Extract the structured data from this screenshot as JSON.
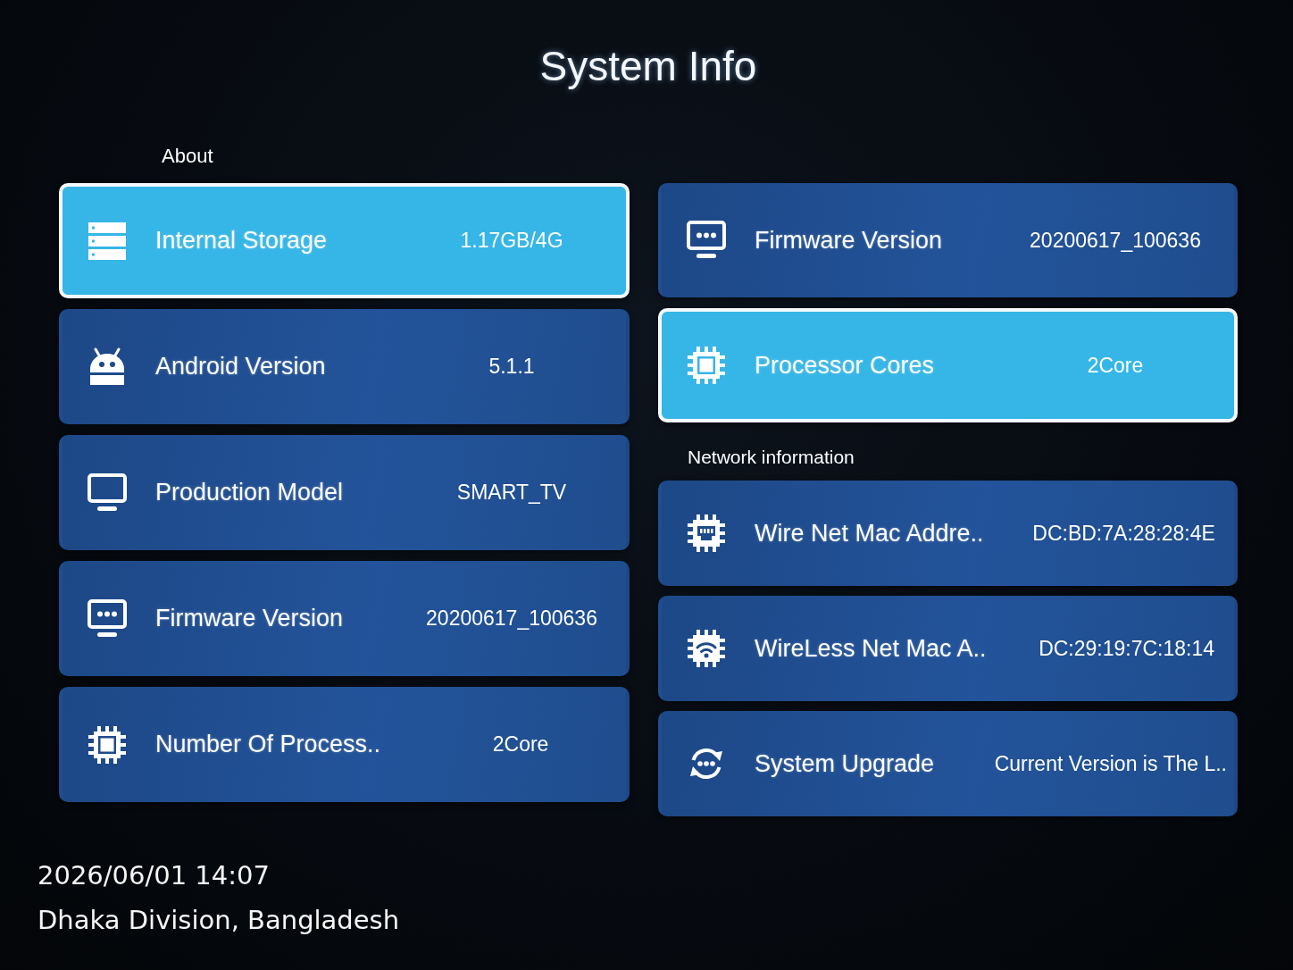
{
  "title": "System Info",
  "about": {
    "heading": "About",
    "items": [
      {
        "kind": "storage",
        "label": "Internal Storage",
        "value": "1.17GB/4G",
        "selected": true
      },
      {
        "kind": "android",
        "label": "Android Version",
        "value": "5.1.1",
        "selected": false
      },
      {
        "kind": "monitor",
        "label": "Production Model",
        "value": "SMART_TV",
        "selected": false
      },
      {
        "kind": "firmware",
        "label": "Firmware Version",
        "value": "20200617_100636",
        "selected": false
      },
      {
        "kind": "chip",
        "label": "Number Of Process..",
        "value": "2Core",
        "selected": false
      },
      {
        "kind": "firmware",
        "label": "Firmware Version",
        "value": "20200617_100636",
        "selected": false
      },
      {
        "kind": "chip",
        "label": "Processor Cores",
        "value": "2Core",
        "selected": true
      }
    ]
  },
  "network": {
    "heading": "Network information",
    "items": [
      {
        "kind": "ethernet",
        "label": "Wire Net Mac Addre..",
        "value": "DC:BD:7A:28:28:4E",
        "selected": false
      },
      {
        "kind": "wifi",
        "label": "WireLess Net Mac A..",
        "value": "DC:29:19:7C:18:14",
        "selected": false
      },
      {
        "kind": "upgrade",
        "label": "System Upgrade",
        "value": "Current Version is The L..",
        "selected": false
      }
    ]
  },
  "photo_stamp": {
    "datetime": "2026/06/01 14:07",
    "location": "Dhaka Division, Bangladesh"
  }
}
